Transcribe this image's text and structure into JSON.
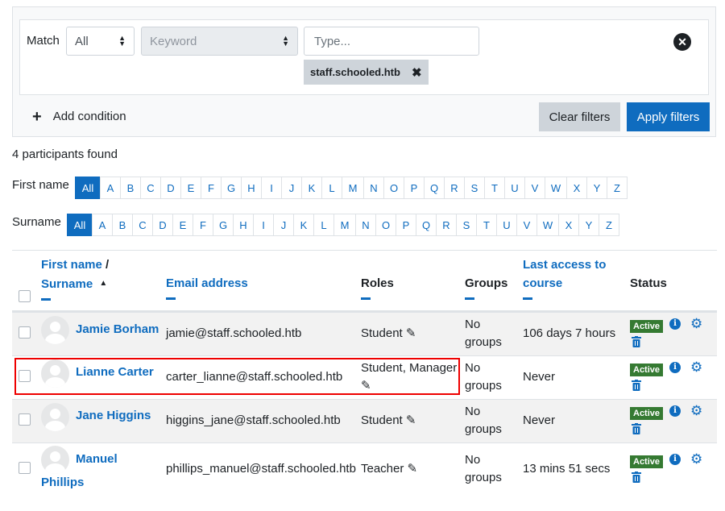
{
  "filters": {
    "match_label": "Match",
    "match_value": "All",
    "field_value": "Keyword",
    "type_placeholder": "Type...",
    "tag_label": "staff.schooled.htb",
    "add_condition": "Add condition",
    "clear_filters": "Clear filters",
    "apply_filters": "Apply filters"
  },
  "participants_found": "4 participants found",
  "initials": {
    "firstname_label": "First name",
    "surname_label": "Surname",
    "letters": [
      "All",
      "A",
      "B",
      "C",
      "D",
      "E",
      "F",
      "G",
      "H",
      "I",
      "J",
      "K",
      "L",
      "M",
      "N",
      "O",
      "P",
      "Q",
      "R",
      "S",
      "T",
      "U",
      "V",
      "W",
      "X",
      "Y",
      "Z"
    ]
  },
  "table": {
    "headers": {
      "firstname": "First name",
      "slash": " /",
      "surname": "Surname",
      "email": "Email address",
      "roles": "Roles",
      "groups": "Groups",
      "last_access_1": "Last access to",
      "last_access_2": "course",
      "status": "Status"
    },
    "rows": [
      {
        "name": "Jamie Borham",
        "email": "jamie@staff.schooled.htb",
        "roles": "Student",
        "groups_1": "No",
        "groups_2": "groups",
        "last_access": "106 days 7 hours",
        "status": "Active"
      },
      {
        "name": "Lianne Carter",
        "email": "carter_lianne@staff.schooled.htb",
        "roles": "Student, Manager",
        "groups_1": "No",
        "groups_2": "groups",
        "last_access": "Never",
        "status": "Active"
      },
      {
        "name": "Jane Higgins",
        "email": "higgins_jane@staff.schooled.htb",
        "roles": "Student",
        "groups_1": "No",
        "groups_2": "groups",
        "last_access": "Never",
        "status": "Active"
      },
      {
        "name_1": "Manuel",
        "name_2": "Phillips",
        "email": "phillips_manuel@staff.schooled.htb",
        "roles": "Teacher",
        "groups_1": "No",
        "groups_2": "groups",
        "last_access": "13 mins 51 secs",
        "status": "Active"
      }
    ]
  },
  "colors": {
    "link": "#0f6cbf",
    "badge": "#357a32",
    "highlight": "#ee0000"
  }
}
